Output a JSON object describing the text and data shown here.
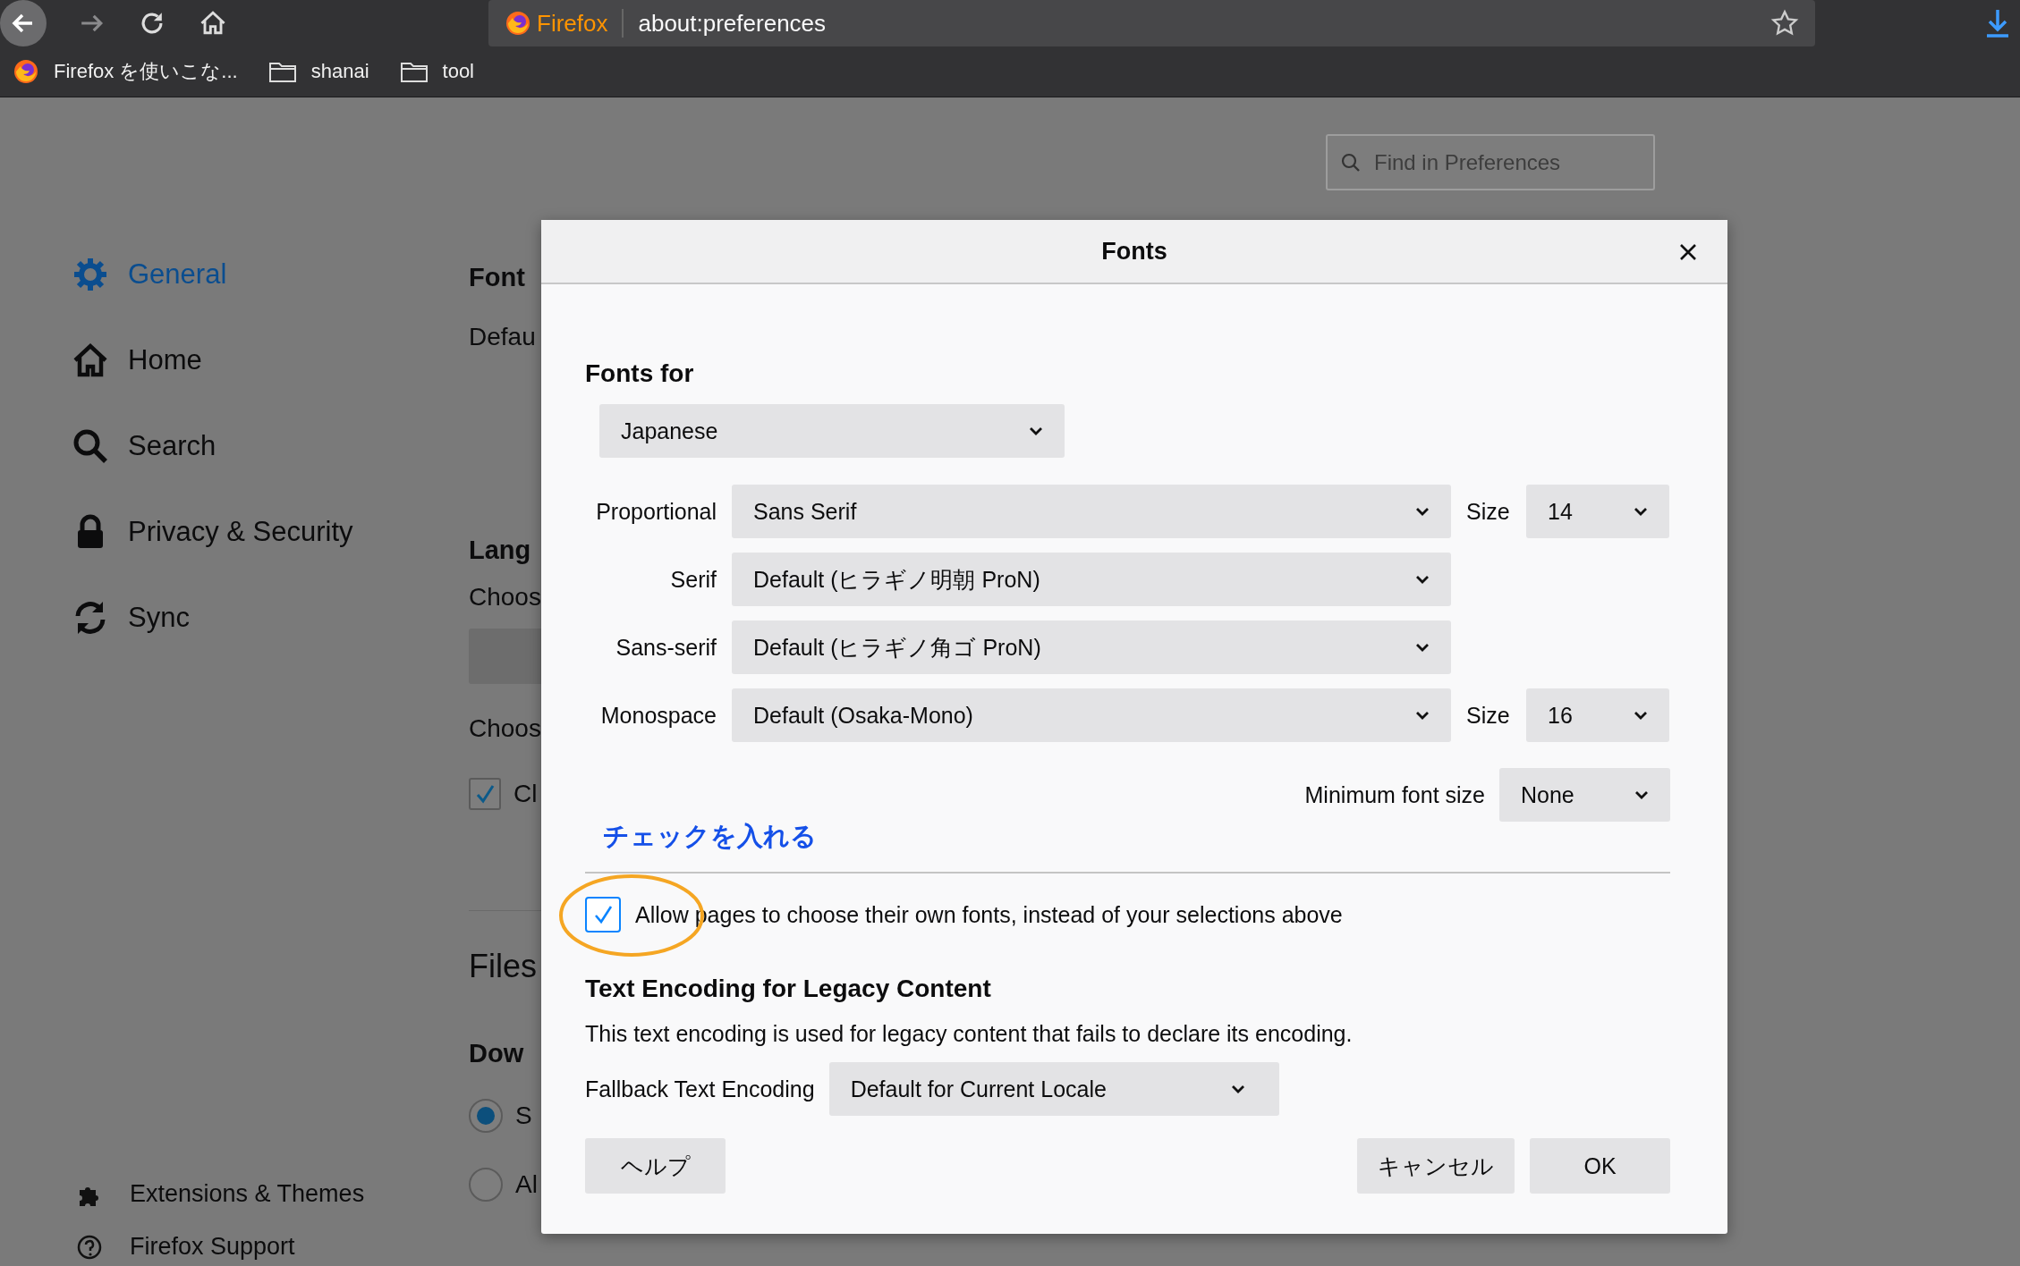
{
  "toolbar": {
    "brand": "Firefox",
    "url": "about:preferences"
  },
  "bookmarks": [
    {
      "label": "Firefox を使いこな...",
      "kind": "site"
    },
    {
      "label": "shanai",
      "kind": "folder"
    },
    {
      "label": "tool",
      "kind": "folder"
    }
  ],
  "search": {
    "placeholder": "Find in Preferences"
  },
  "sidebar": {
    "items": [
      {
        "label": "General",
        "kind": "gear",
        "selected": true
      },
      {
        "label": "Home",
        "kind": "home",
        "selected": false
      },
      {
        "label": "Search",
        "kind": "search",
        "selected": false
      },
      {
        "label": "Privacy & Security",
        "kind": "lock",
        "selected": false
      },
      {
        "label": "Sync",
        "kind": "sync",
        "selected": false
      }
    ],
    "footer_items": [
      {
        "label": "Extensions & Themes",
        "kind": "puzzle"
      },
      {
        "label": "Firefox Support",
        "kind": "help"
      }
    ]
  },
  "background_content": [
    {
      "kind": "heading",
      "text": "Font"
    },
    {
      "kind": "text",
      "text": "Defau"
    },
    {
      "kind": "heading",
      "text": "Lang"
    },
    {
      "kind": "text",
      "text": "Choos"
    },
    {
      "kind": "bar"
    },
    {
      "kind": "text",
      "text": "Choos"
    },
    {
      "kind": "checkbox",
      "text": "Cl",
      "checked": true
    },
    {
      "kind": "divider"
    },
    {
      "kind": "title",
      "text": "Files"
    },
    {
      "kind": "heading",
      "text": "Dow"
    },
    {
      "kind": "radio",
      "text": "S",
      "selected": true
    },
    {
      "kind": "radio",
      "text": "Al",
      "selected": false
    }
  ],
  "dialog": {
    "title": "Fonts",
    "fonts_for": {
      "heading": "Fonts for",
      "value": "Japanese"
    },
    "rows": [
      {
        "label": "Proportional",
        "value": "Sans Serif",
        "size_label": "Size",
        "size": "14"
      },
      {
        "label": "Serif",
        "value": "Default (ヒラギノ明朝 ProN)"
      },
      {
        "label": "Sans-serif",
        "value": "Default (ヒラギノ角ゴ ProN)"
      },
      {
        "label": "Monospace",
        "value": "Default (Osaka-Mono)",
        "size_label": "Size",
        "size": "16"
      }
    ],
    "minimum": {
      "label": "Minimum font size",
      "value": "None"
    },
    "annotation": "チェックを入れる",
    "allow": {
      "label": "Allow pages to choose their own fonts, instead of your selections above",
      "checked": true
    },
    "encoding": {
      "heading": "Text Encoding for Legacy Content",
      "description": "This text encoding is used for legacy content that fails to declare its encoding.",
      "label": "Fallback Text Encoding",
      "value": "Default for Current Locale"
    },
    "buttons": [
      {
        "label": "ヘルプ",
        "kind": "help"
      },
      {
        "label": "キャンセル",
        "kind": "cancel"
      },
      {
        "label": "OK",
        "kind": "ok"
      }
    ]
  }
}
